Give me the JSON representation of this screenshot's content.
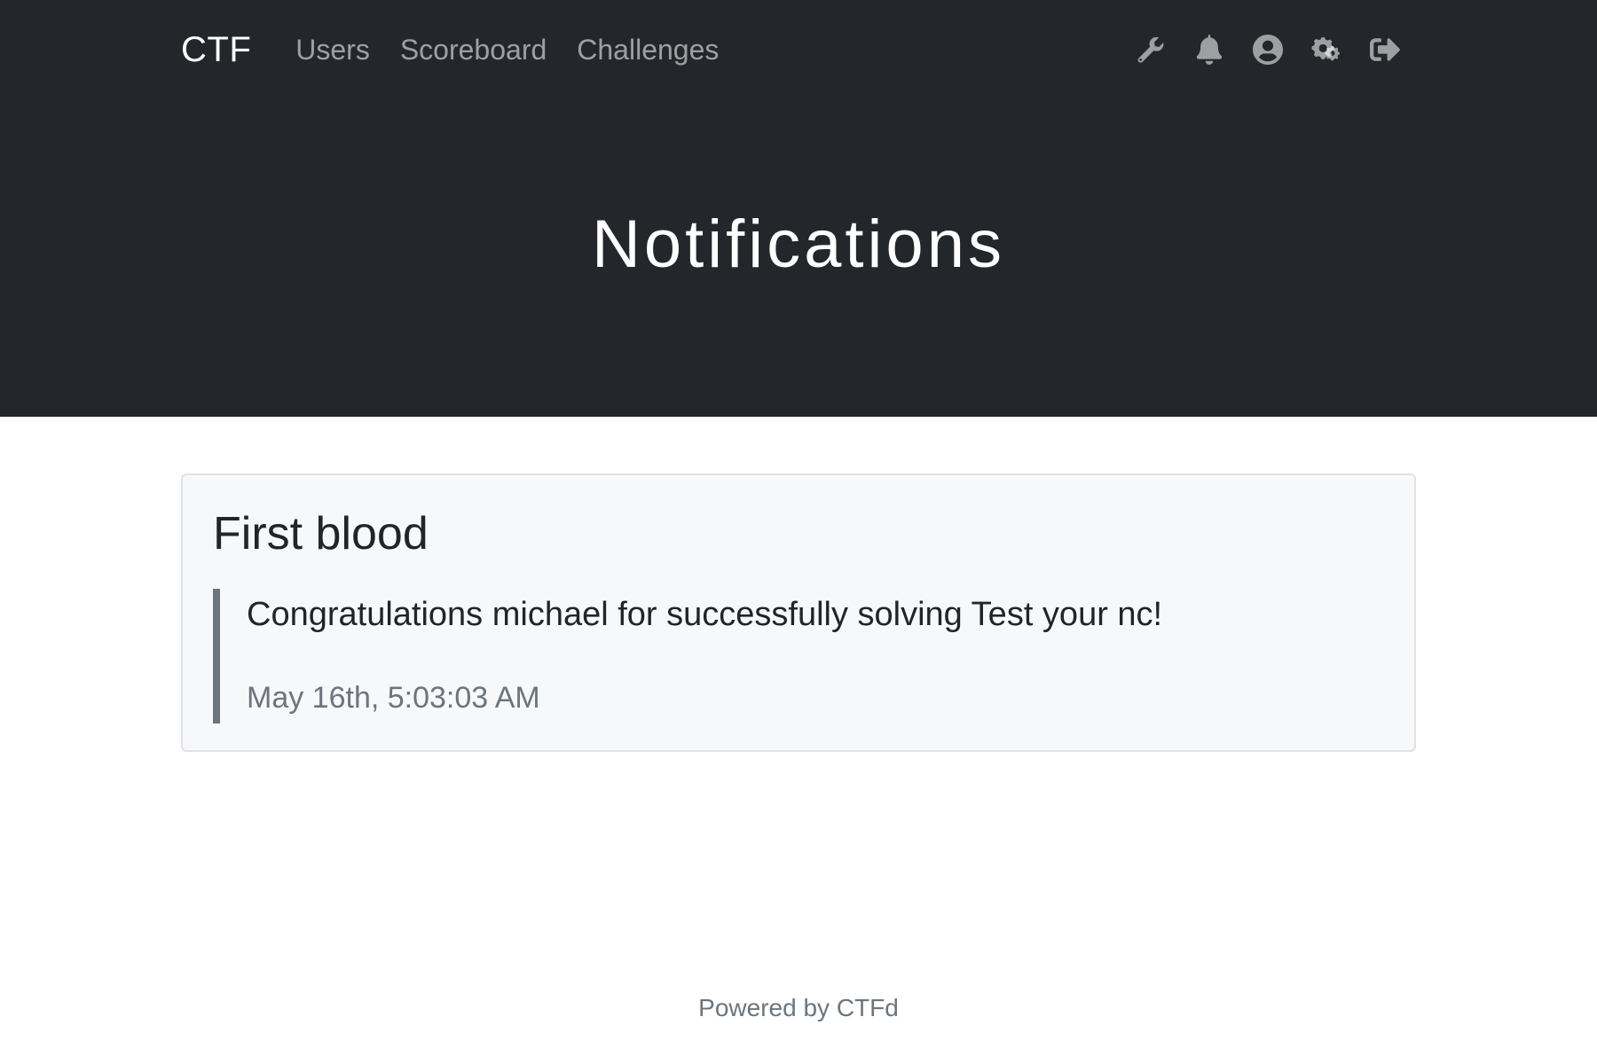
{
  "navbar": {
    "brand": "CTF",
    "links": [
      {
        "label": "Users"
      },
      {
        "label": "Scoreboard"
      },
      {
        "label": "Challenges"
      }
    ],
    "icons": [
      "wrench-icon",
      "bell-icon",
      "user-circle-icon",
      "cogs-icon",
      "sign-out-icon"
    ]
  },
  "page": {
    "title": "Notifications"
  },
  "notifications": [
    {
      "title": "First blood",
      "content": "Congratulations michael for successfully solving Test your nc!",
      "time": "May 16th, 5:03:03 AM"
    }
  ],
  "footer": {
    "text": "Powered by CTFd"
  },
  "colors": {
    "header_bg": "#23262b",
    "card_bg": "#f7f8fa",
    "quote_border": "#6c757d",
    "muted_text": "#6c757d"
  }
}
